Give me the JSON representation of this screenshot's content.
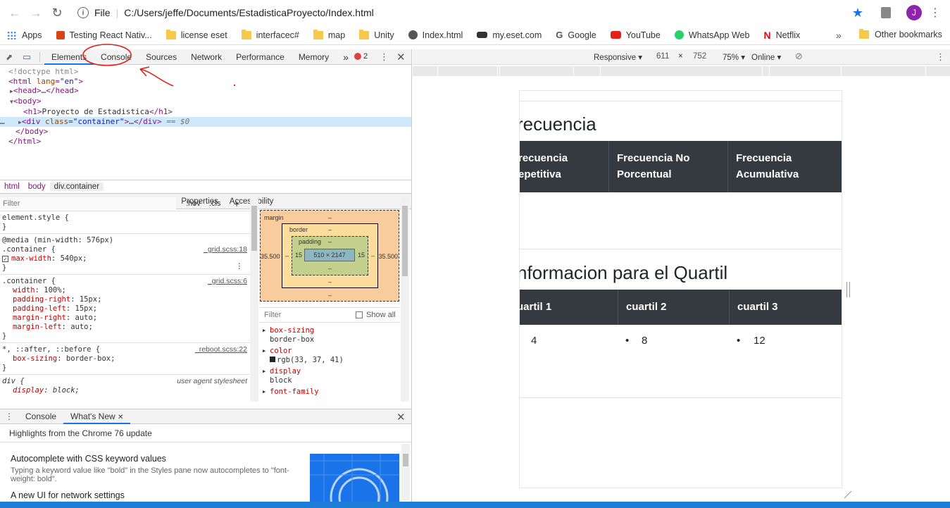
{
  "browser": {
    "file_label": "File",
    "url": "C:/Users/jeffe/Documents/EstadisticaProyecto/Index.html",
    "profile_initial": "J",
    "bookmarks": [
      {
        "label": "Apps",
        "icon": "apps-grid-icon"
      },
      {
        "label": "Testing React Nativ...",
        "icon": "react-icon"
      },
      {
        "label": "license eset",
        "icon": "folder-icon"
      },
      {
        "label": "interfacec#",
        "icon": "folder-icon"
      },
      {
        "label": "map",
        "icon": "folder-icon"
      },
      {
        "label": "Unity",
        "icon": "folder-icon"
      },
      {
        "label": "Index.html",
        "icon": "globe-icon"
      },
      {
        "label": "my.eset.com",
        "icon": "eset-icon"
      },
      {
        "label": "Google",
        "icon": "google-icon"
      },
      {
        "label": "YouTube",
        "icon": "youtube-icon"
      },
      {
        "label": "WhatsApp Web",
        "icon": "whatsapp-icon"
      },
      {
        "label": "Netflix",
        "icon": "netflix-icon"
      }
    ],
    "more_glyph": "»",
    "other_bookmarks": "Other bookmarks"
  },
  "devtools": {
    "tabs": [
      "Elements",
      "Console",
      "Sources",
      "Network",
      "Performance",
      "Memory"
    ],
    "tabs_more": "»",
    "error_count": "2",
    "dom": {
      "doctype": "<!doctype html>",
      "html_open_tag": "html",
      "html_open_attr": "lang",
      "html_open_val": "\"en\"",
      "head": "head",
      "head_ellipsis": "…",
      "body": "body",
      "h1_text": "Proyecto de Estadistica",
      "h1": "h1",
      "div": "div",
      "div_attr": "class",
      "div_val": "\"container\"",
      "div_ellipsis": "…",
      "selected_marker": "== $0",
      "row_ellipsis": "…",
      "html_close": "html"
    },
    "breadcrumbs": [
      "html",
      "body",
      "div.container"
    ],
    "style_tabs": [
      "Styles",
      "Event Listeners",
      "DOM Breakpoints",
      "Properties",
      "Accessibility"
    ],
    "filter_placeholder": "Filter",
    "hov": ":hov",
    "cls": ".cls",
    "rules": {
      "element_style": "element.style {",
      "close_brace": "}",
      "media": "@media (min-width: 576px)",
      "container_sel": ".container {",
      "src_grid18": "_grid.scss:18",
      "max_width_prop": "max-width",
      "max_width_val": "540px;",
      "src_grid6": "_grid.scss:6",
      "width_prop": "width",
      "width_val": "100%;",
      "pr_prop": "padding-right",
      "pr_val": "15px;",
      "pl_prop": "padding-left",
      "pl_val": "15px;",
      "mr_prop": "margin-right",
      "mr_val": "auto;",
      "ml_prop": "margin-left",
      "ml_val": "auto;",
      "star_sel": "*, ::after, ::before {",
      "src_reboot": "_reboot.scss:22",
      "bs_prop": "box-sizing",
      "bs_val": "border-box;",
      "div_sel": "div {",
      "src_ua": "user agent stylesheet",
      "display_prop": "display",
      "display_val": "block;"
    },
    "box_model": {
      "margin_label": "margin",
      "border_label": "border",
      "padding_label": "padding",
      "dash": "–",
      "margin_side": "35.500",
      "padding_side": "15",
      "content": "510 × 2147"
    },
    "computed": {
      "filter": "Filter",
      "show_all": "Show all",
      "props": [
        {
          "name": "box-sizing",
          "value": "border-box"
        },
        {
          "name": "color",
          "value": "rgb(33, 37, 41)"
        },
        {
          "name": "display",
          "value": "block"
        },
        {
          "name": "font-family",
          "value": ""
        }
      ]
    },
    "drawer": {
      "tabs": [
        "Console",
        "What's New"
      ],
      "heading": "Highlights from the Chrome 76 update",
      "item1_title": "Autocomplete with CSS keyword values",
      "item1_text": "Typing a keyword value like \"bold\" in the Styles pane now autocompletes to \"font-weight: bold\".",
      "item2_title": "A new UI for network settings"
    }
  },
  "device_toolbar": {
    "mode": "Responsive",
    "width": "611",
    "times": "×",
    "height": "752",
    "zoom": "75%",
    "network": "Online"
  },
  "page": {
    "heading1": "recuencia",
    "table1_headers": [
      {
        "line1": "recuencia",
        "line2": "epetitiva"
      },
      {
        "line1": "Frecuencia No",
        "line2": "Porcentual"
      },
      {
        "line1": "Frecuencia",
        "line2": "Acumulativa"
      }
    ],
    "heading2": "nformacion para el Quartil",
    "table2_headers": [
      "uartil 1",
      "cuartil 2",
      "cuartil 3"
    ],
    "table2_values": [
      "4",
      "8",
      "12"
    ],
    "bullet": "•"
  },
  "colors": {
    "accent": "#1a73e8",
    "table_header_bg": "#343a40",
    "annotation_red": "#e0201b"
  }
}
